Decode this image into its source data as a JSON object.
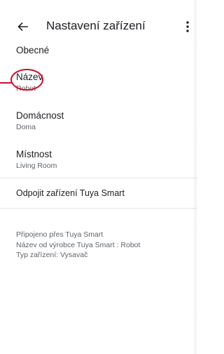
{
  "appbar": {
    "back_icon": "arrow-left-icon",
    "title": "Nastavení zařízení",
    "more_icon": "more-vert-icon"
  },
  "general": {
    "header": "Obecné",
    "items": [
      {
        "label": "Název",
        "value": "Robot"
      },
      {
        "label": "Domácnost",
        "value": "Doma"
      },
      {
        "label": "Místnost",
        "value": "Living Room"
      }
    ]
  },
  "unlink": {
    "label": "Odpojit zařízení Tuya Smart"
  },
  "info": {
    "lines": [
      "Připojeno přes Tuya Smart",
      "Název od výrobce Tuya Smart : Robot",
      "Typ zařízení: Vysavač"
    ]
  },
  "colors": {
    "annotation": "#c8102e",
    "text_primary": "#202124",
    "text_secondary": "#5f6368",
    "divider": "#e3e3e3"
  }
}
